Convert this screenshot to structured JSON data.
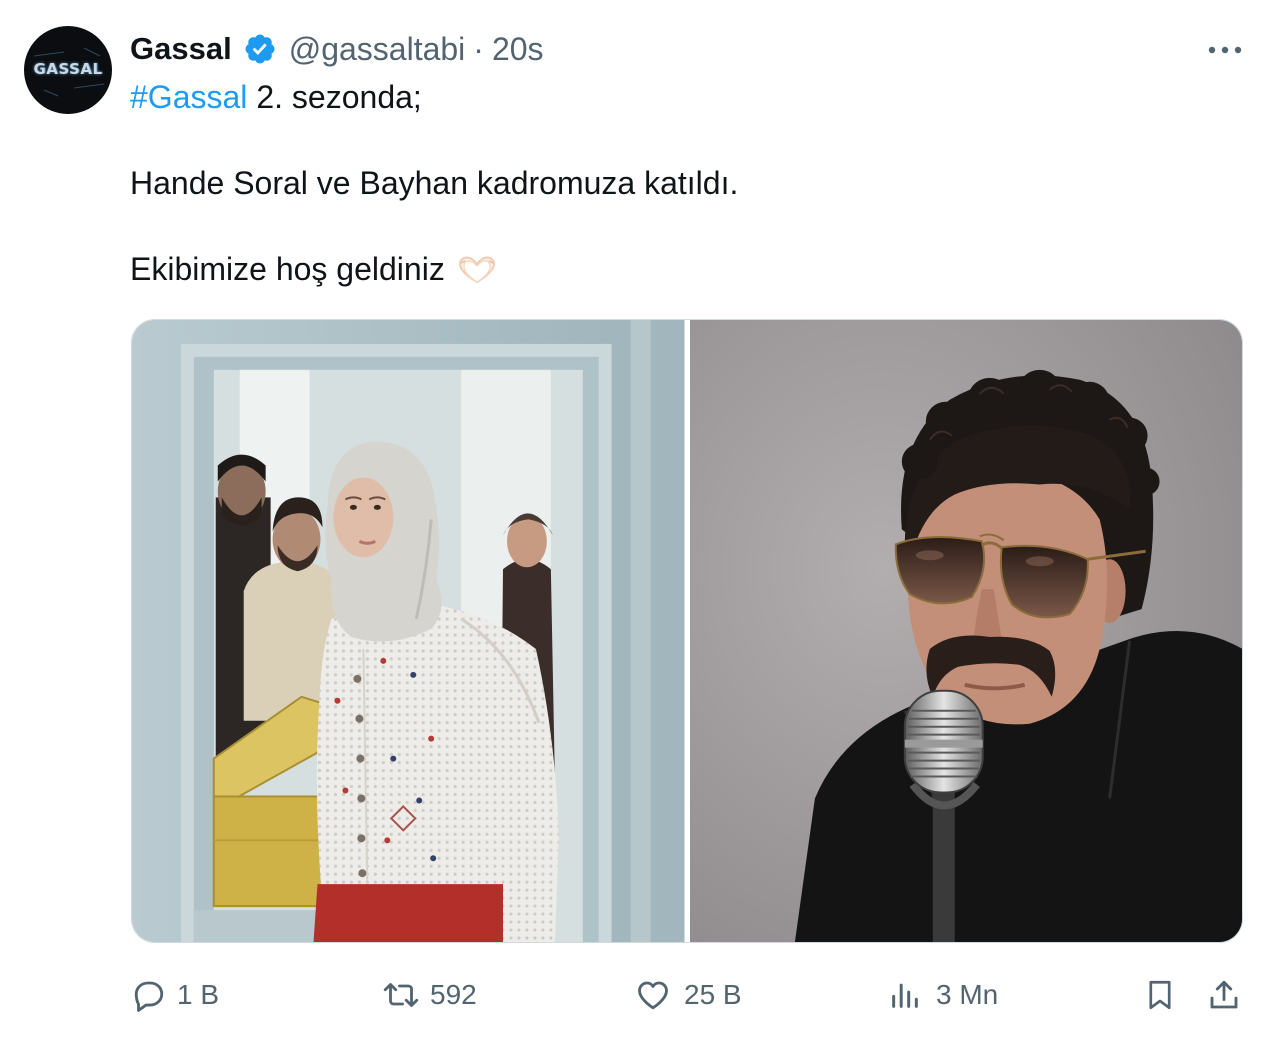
{
  "tweet": {
    "author": {
      "avatar_logo_text": "GASSAL",
      "name": "Gassal",
      "verified_icon": "verified-badge-icon",
      "handle": "@gassaltabi",
      "separator": "·",
      "time": "20s"
    },
    "more_icon": "more-horizontal-icon",
    "body": {
      "hashtag": "#Gassal",
      "line1": "2. sezonda;",
      "line2": "Hande Soral ve Bayhan kadromuza katıldı.",
      "line3": "Ekibimize hoş geldiniz",
      "line3_emoji_icon": "heart-hands-icon"
    },
    "actions": {
      "reply": {
        "icon": "reply-icon",
        "count": "1 B"
      },
      "repost": {
        "icon": "repost-icon",
        "count": "592"
      },
      "like": {
        "icon": "like-icon",
        "count": "25 B"
      },
      "views": {
        "icon": "views-icon",
        "count": "3 Mn"
      },
      "bookmark": {
        "icon": "bookmark-icon"
      },
      "share": {
        "icon": "share-icon"
      }
    }
  },
  "colors": {
    "text": "#0f1419",
    "secondary": "#536471",
    "accent": "#1d9bf0",
    "avatar_bg": "#0b0d10",
    "border": "#cfd9de"
  }
}
